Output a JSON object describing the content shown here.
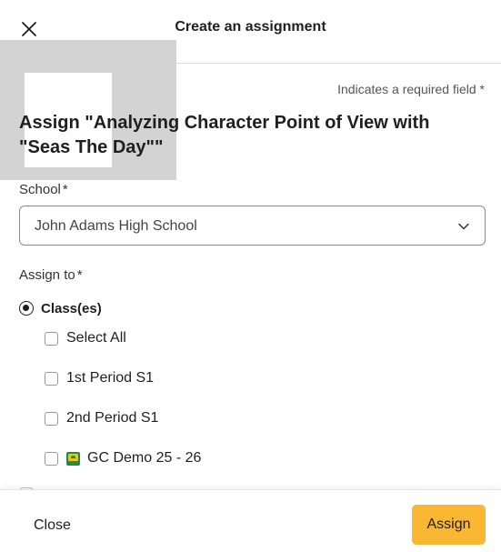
{
  "header": {
    "title": "Create an assignment",
    "close_icon": "close-icon"
  },
  "form": {
    "required_note": "Indicates a required field *",
    "assign_title": "Assign \"Analyzing Character Point of View with \"Seas The Day\"\"",
    "school": {
      "label": "School",
      "required_mark": "*",
      "selected": "John Adams High School",
      "chevron_icon": "chevron-down-icon"
    },
    "assign_to": {
      "label": "Assign to",
      "required_mark": "*",
      "option_label": "Class(es)",
      "selected": true
    },
    "classes": [
      {
        "label": "Select All",
        "checked": false
      },
      {
        "label": "1st Period S1",
        "checked": false
      },
      {
        "label": "2nd Period S1",
        "checked": false
      },
      {
        "label": "GC Demo 25 - 26",
        "checked": false,
        "icon": "google-classroom-icon"
      }
    ]
  },
  "footer": {
    "close_label": "Close",
    "assign_label": "Assign"
  },
  "colors": {
    "accent": "#f9b732",
    "overlay": "#d3d3d3"
  }
}
